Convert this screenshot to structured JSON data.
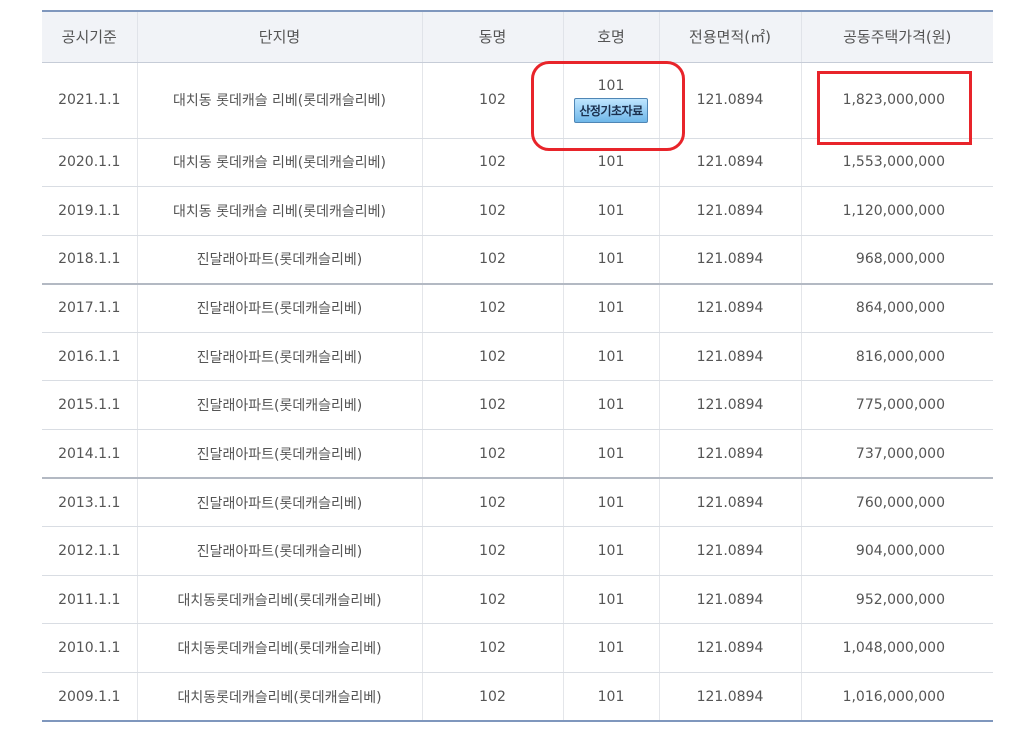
{
  "columns": [
    "공시기준",
    "단지명",
    "동명",
    "호명",
    "전용면적(㎡)",
    "공동주택가격(원)"
  ],
  "basis_button_label": "산정기초자료",
  "rows": [
    {
      "date": "2021.1.1",
      "complex": "대치동 롯데캐슬 리베(롯데캐슬리베)",
      "dong": "102",
      "ho": "101",
      "area": "121.0894",
      "price": "1,823,000,000"
    },
    {
      "date": "2020.1.1",
      "complex": "대치동 롯데캐슬 리베(롯데캐슬리베)",
      "dong": "102",
      "ho": "101",
      "area": "121.0894",
      "price": "1,553,000,000"
    },
    {
      "date": "2019.1.1",
      "complex": "대치동 롯데캐슬 리베(롯데캐슬리베)",
      "dong": "102",
      "ho": "101",
      "area": "121.0894",
      "price": "1,120,000,000"
    },
    {
      "date": "2018.1.1",
      "complex": "진달래아파트(롯데캐슬리베)",
      "dong": "102",
      "ho": "101",
      "area": "121.0894",
      "price": "968,000,000"
    },
    {
      "date": "2017.1.1",
      "complex": "진달래아파트(롯데캐슬리베)",
      "dong": "102",
      "ho": "101",
      "area": "121.0894",
      "price": "864,000,000"
    },
    {
      "date": "2016.1.1",
      "complex": "진달래아파트(롯데캐슬리베)",
      "dong": "102",
      "ho": "101",
      "area": "121.0894",
      "price": "816,000,000"
    },
    {
      "date": "2015.1.1",
      "complex": "진달래아파트(롯데캐슬리베)",
      "dong": "102",
      "ho": "101",
      "area": "121.0894",
      "price": "775,000,000"
    },
    {
      "date": "2014.1.1",
      "complex": "진달래아파트(롯데캐슬리베)",
      "dong": "102",
      "ho": "101",
      "area": "121.0894",
      "price": "737,000,000"
    },
    {
      "date": "2013.1.1",
      "complex": "진달래아파트(롯데캐슬리베)",
      "dong": "102",
      "ho": "101",
      "area": "121.0894",
      "price": "760,000,000"
    },
    {
      "date": "2012.1.1",
      "complex": "진달래아파트(롯데캐슬리베)",
      "dong": "102",
      "ho": "101",
      "area": "121.0894",
      "price": "904,000,000"
    },
    {
      "date": "2011.1.1",
      "complex": "대치동롯데캐슬리베(롯데캐슬리베)",
      "dong": "102",
      "ho": "101",
      "area": "121.0894",
      "price": "952,000,000"
    },
    {
      "date": "2010.1.1",
      "complex": "대치동롯데캐슬리베(롯데캐슬리베)",
      "dong": "102",
      "ho": "101",
      "area": "121.0894",
      "price": "1,048,000,000"
    },
    {
      "date": "2009.1.1",
      "complex": "대치동롯데캐슬리베(롯데캐슬리베)",
      "dong": "102",
      "ho": "101",
      "area": "121.0894",
      "price": "1,016,000,000"
    }
  ],
  "colors": {
    "highlight": "#e8242a",
    "header_bg": "#f1f3f7",
    "accent_border": "#7f97bd"
  }
}
